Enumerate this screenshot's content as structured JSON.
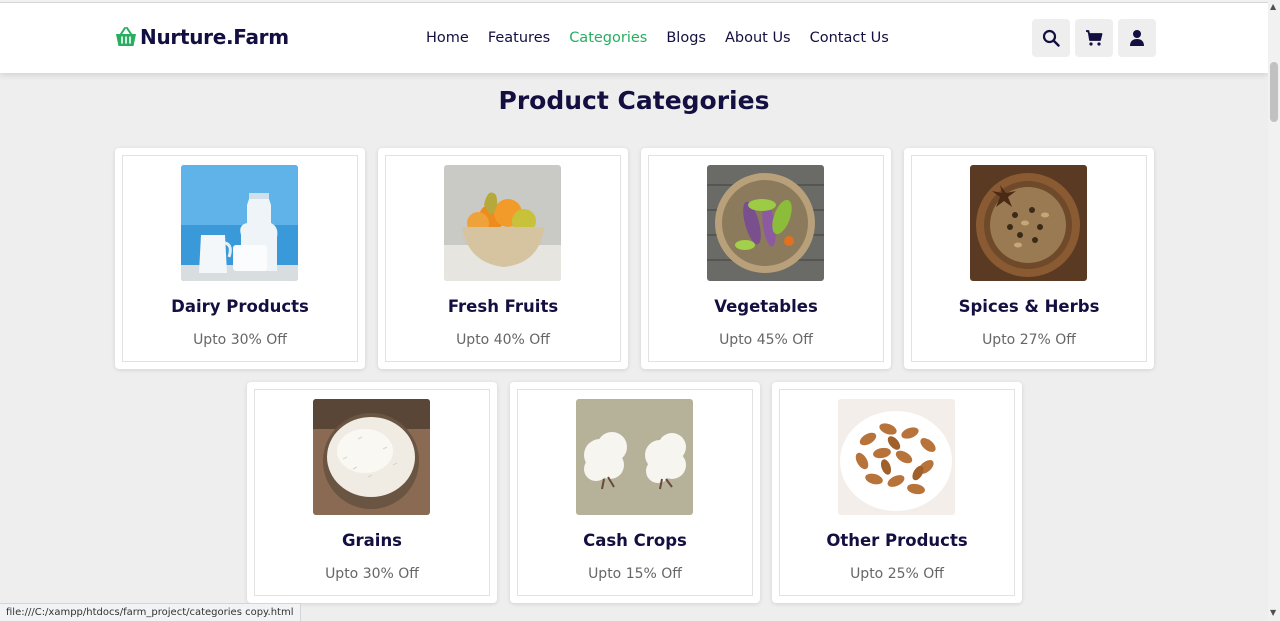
{
  "brand": {
    "name": "Nurture.Farm",
    "color": "#27ae60",
    "icon": "basket-icon"
  },
  "nav": [
    {
      "label": "Home",
      "active": false
    },
    {
      "label": "Features",
      "active": false
    },
    {
      "label": "Categories",
      "active": true
    },
    {
      "label": "Blogs",
      "active": false
    },
    {
      "label": "About Us",
      "active": false
    },
    {
      "label": "Contact Us",
      "active": false
    }
  ],
  "header_icons": [
    "search-icon",
    "cart-icon",
    "user-icon"
  ],
  "section": {
    "title": "Product Categories"
  },
  "categories": [
    {
      "title": "Dairy Products",
      "offer": "Upto 30% Off",
      "image": "milk-bottles-image"
    },
    {
      "title": "Fresh Fruits",
      "offer": "Upto 40% Off",
      "image": "fruit-bowl-image"
    },
    {
      "title": "Vegetables",
      "offer": "Upto 45% Off",
      "image": "vegetable-basket-image"
    },
    {
      "title": "Spices & Herbs",
      "offer": "Upto 27% Off",
      "image": "spices-bowl-image"
    },
    {
      "title": "Grains",
      "offer": "Upto 30% Off",
      "image": "rice-bowl-image"
    },
    {
      "title": "Cash Crops",
      "offer": "Upto 15% Off",
      "image": "cotton-image"
    },
    {
      "title": "Other Products",
      "offer": "Upto 25% Off",
      "image": "peanuts-bowl-image"
    }
  ],
  "status_bar": {
    "url": "file:///C:/xampp/htdocs/farm_project/categories copy.html"
  },
  "colors": {
    "heading": "#130f40",
    "accent": "#27ae60",
    "background": "#eeeeee"
  }
}
